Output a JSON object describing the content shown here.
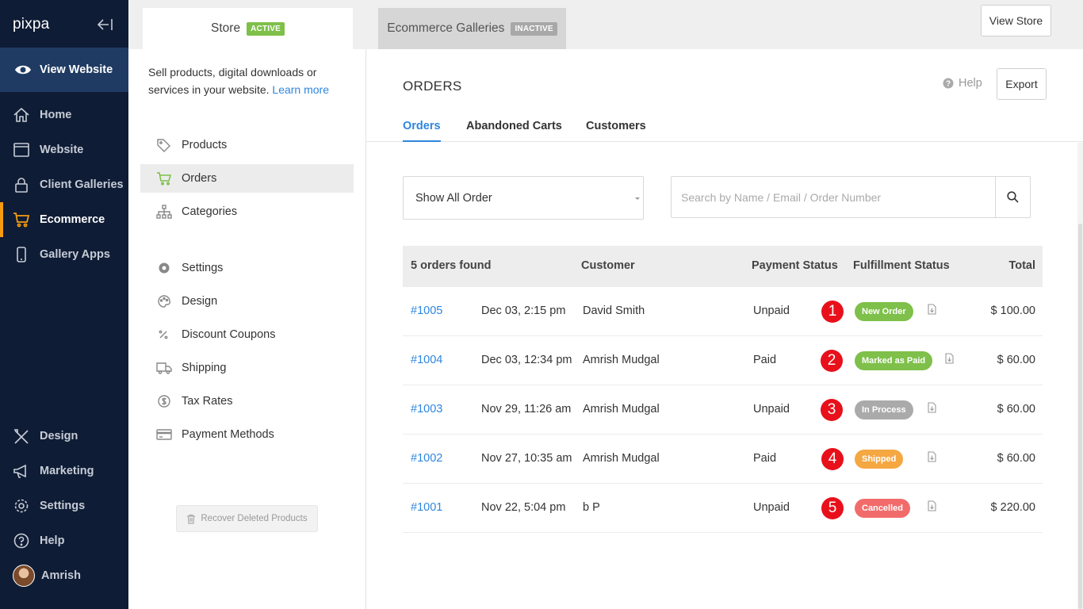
{
  "sidebar": {
    "brand": "pixpa",
    "view_website": "View Website",
    "nav": [
      {
        "label": "Home",
        "icon": "home-icon"
      },
      {
        "label": "Website",
        "icon": "browser-icon"
      },
      {
        "label": "Client Galleries",
        "icon": "lock-icon"
      },
      {
        "label": "Ecommerce",
        "icon": "cart-icon",
        "active": true
      },
      {
        "label": "Gallery Apps",
        "icon": "mobile-icon"
      }
    ],
    "bottom_nav": [
      {
        "label": "Design",
        "icon": "design-tools-icon"
      },
      {
        "label": "Marketing",
        "icon": "megaphone-icon"
      },
      {
        "label": "Settings",
        "icon": "gear-icon"
      },
      {
        "label": "Help",
        "icon": "help-circle-icon"
      }
    ],
    "user": "Amrish"
  },
  "topbar": {
    "store_tab": "Store",
    "store_badge": "ACTIVE",
    "galleries_tab": "Ecommerce Galleries",
    "galleries_badge": "INACTIVE",
    "view_store": "View Store"
  },
  "subnav": {
    "intro": "Sell products, digital downloads or services in your website.",
    "learn_more": "Learn more",
    "items_top": [
      {
        "label": "Products",
        "icon": "tag-icon"
      },
      {
        "label": "Orders",
        "icon": "cart-icon",
        "active": true
      },
      {
        "label": "Categories",
        "icon": "sitemap-icon"
      }
    ],
    "items_bottom": [
      {
        "label": "Settings",
        "icon": "gear-icon"
      },
      {
        "label": "Design",
        "icon": "palette-icon"
      },
      {
        "label": "Discount Coupons",
        "icon": "percent-icon"
      },
      {
        "label": "Shipping",
        "icon": "truck-icon"
      },
      {
        "label": "Tax Rates",
        "icon": "dollar-circle-icon"
      },
      {
        "label": "Payment Methods",
        "icon": "credit-card-icon"
      }
    ],
    "recover": "Recover Deleted Products"
  },
  "main": {
    "title": "ORDERS",
    "help": "Help",
    "export": "Export",
    "tabs": [
      "Orders",
      "Abandoned Carts",
      "Customers"
    ],
    "filter_value": "Show All Order",
    "search_placeholder": "Search by Name / Email / Order Number",
    "table": {
      "headers": {
        "count": "5 orders found",
        "customer": "Customer",
        "payment": "Payment Status",
        "fulfillment": "Fulfillment Status",
        "total": "Total"
      },
      "rows": [
        {
          "id": "#1005",
          "date": "Dec 03, 2:15 pm",
          "customer": "David Smith",
          "payment": "Unpaid",
          "marker": "1",
          "status": "New Order",
          "status_color": "#7ec04a",
          "total": "$ 100.00"
        },
        {
          "id": "#1004",
          "date": "Dec 03, 12:34 pm",
          "customer": "Amrish Mudgal",
          "payment": "Paid",
          "marker": "2",
          "status": "Marked as Paid",
          "status_color": "#7ec04a",
          "total": "$ 60.00"
        },
        {
          "id": "#1003",
          "date": "Nov 29, 11:26 am",
          "customer": "Amrish Mudgal",
          "payment": "Unpaid",
          "marker": "3",
          "status": "In Process",
          "status_color": "#aaaaaa",
          "total": "$ 60.00"
        },
        {
          "id": "#1002",
          "date": "Nov 27, 10:35 am",
          "customer": "Amrish Mudgal",
          "payment": "Paid",
          "marker": "4",
          "status": "Shipped",
          "status_color": "#f5a742",
          "total": "$ 60.00"
        },
        {
          "id": "#1001",
          "date": "Nov 22, 5:04 pm",
          "customer": "b P",
          "payment": "Unpaid",
          "marker": "5",
          "status": "Cancelled",
          "status_color": "#f26b6b",
          "total": "$ 220.00"
        }
      ]
    }
  }
}
